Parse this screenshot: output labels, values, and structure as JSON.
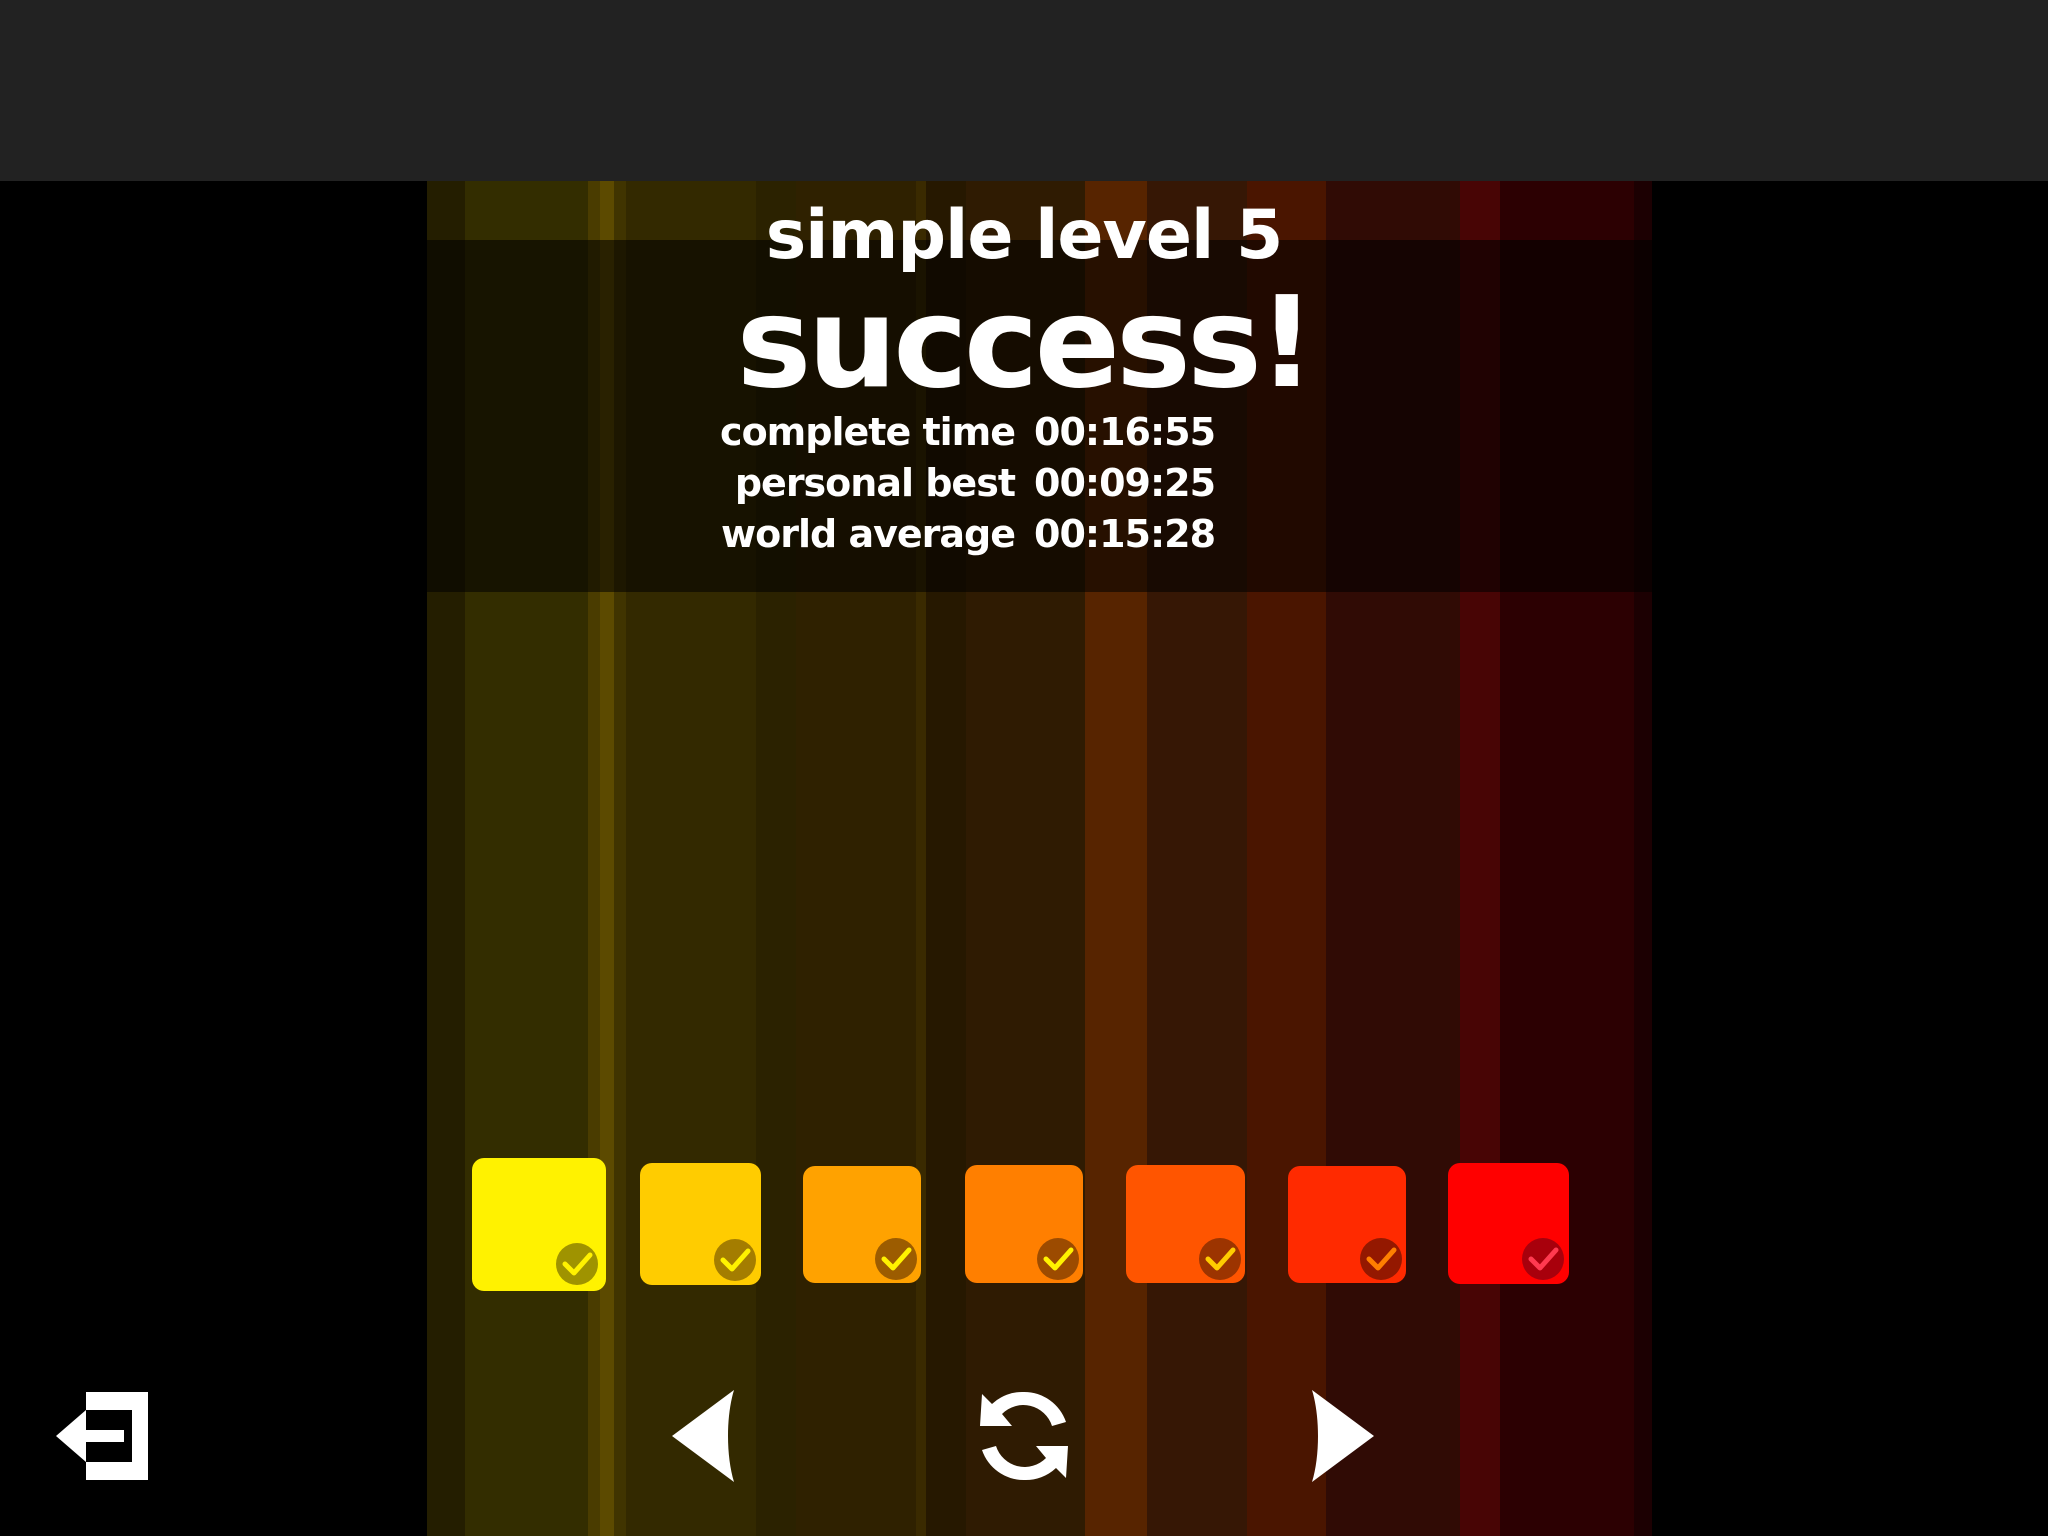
{
  "level_title": "simple level 5",
  "result": "success!",
  "stats": [
    {
      "label": "complete time",
      "value": "00:16:55"
    },
    {
      "label": "personal best",
      "value": "00:09:25"
    },
    {
      "label": "world average",
      "value": "00:15:28"
    }
  ],
  "level_tiles": [
    {
      "color": "#fff200",
      "completed": true
    },
    {
      "color": "#ffcc00",
      "completed": true
    },
    {
      "color": "#ffa200",
      "completed": true
    },
    {
      "color": "#ff7f00",
      "completed": true
    },
    {
      "color": "#ff5500",
      "completed": true
    },
    {
      "color": "#ff2a00",
      "completed": true
    },
    {
      "color": "#ff0000",
      "completed": true
    }
  ],
  "controls": {
    "exit": "exit-icon",
    "previous": "previous-arrow-icon",
    "restart": "restart-icon",
    "next": "next-arrow-icon"
  }
}
